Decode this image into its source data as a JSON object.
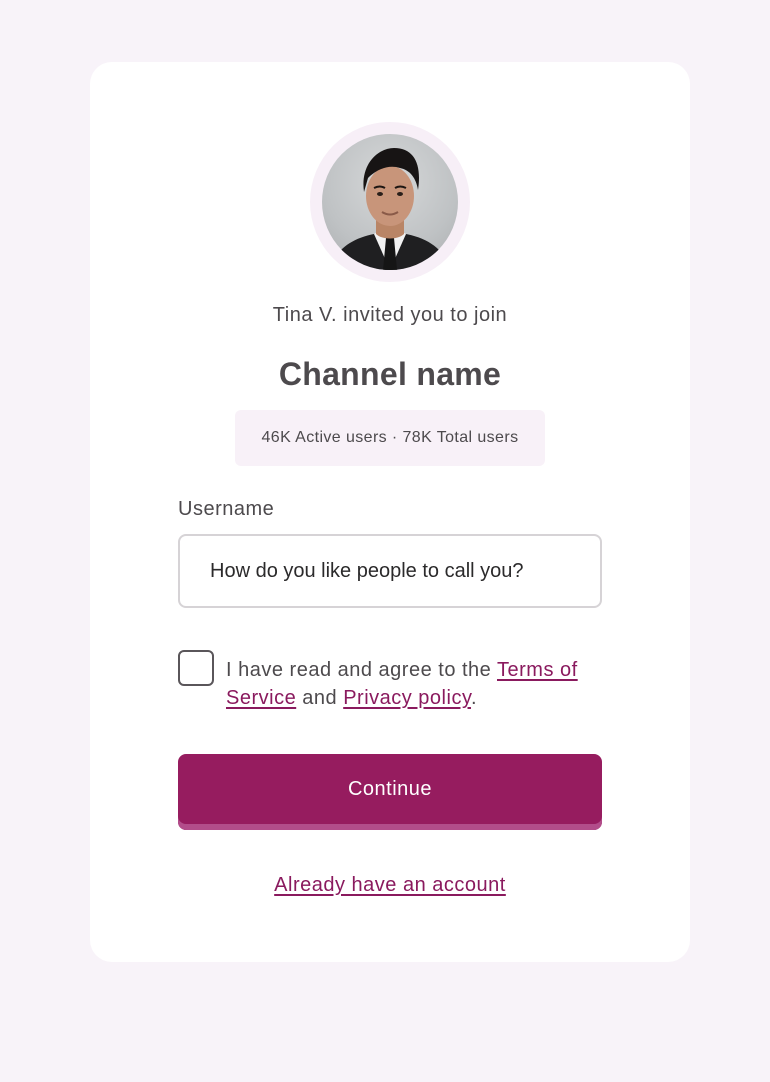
{
  "invite": {
    "inviter_text": "Tina V. invited you to join",
    "channel_name": "Channel name",
    "stats": "46K Active users · 78K Total users"
  },
  "form": {
    "username_label": "Username",
    "username_placeholder": "How do you like people to call you?",
    "username_value": "",
    "terms_checked": false,
    "terms_prefix": "I have read and agree to the ",
    "terms_link": "Terms of Service",
    "terms_middle": " and ",
    "privacy_link": "Privacy policy",
    "terms_suffix": ".",
    "continue_label": "Continue",
    "login_link": "Already have an account"
  },
  "colors": {
    "page_bg": "#f8f3f9",
    "card_bg": "#ffffff",
    "accent": "#961c5f",
    "link": "#8a1a5e",
    "text": "#4d4a4d"
  },
  "icons": {
    "avatar": "user-avatar-photo",
    "checkbox": "checkbox-unchecked"
  }
}
